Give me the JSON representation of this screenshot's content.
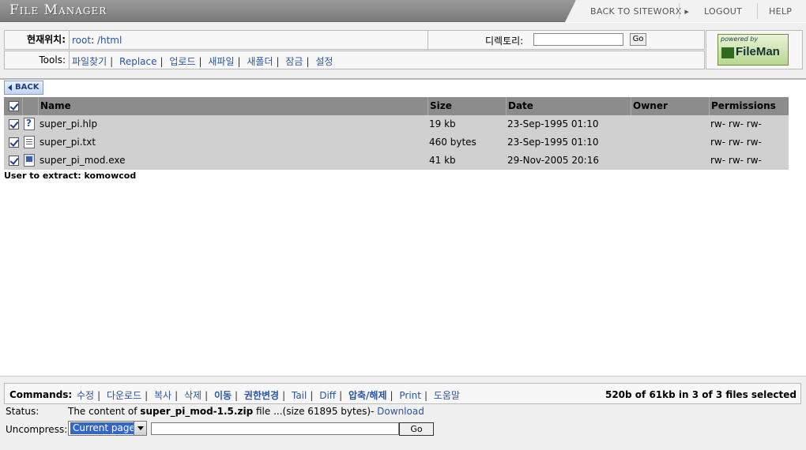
{
  "app": {
    "title": "File Manager"
  },
  "topnav": {
    "back": "BACK TO SITEWORX ▸",
    "logout": "LOGOUT",
    "help": "HELP"
  },
  "location": {
    "label": "현재위치:",
    "root": "root",
    "colon": ":",
    "path": "/html"
  },
  "directory": {
    "label": "디렉토리:",
    "value": "",
    "go": "Go"
  },
  "tools": {
    "label": "Tools:",
    "items": [
      "파일찾기",
      "Replace",
      "업로드",
      "새파일",
      "새폴더",
      "잠금",
      "설정"
    ]
  },
  "logo": {
    "powered": "powered by",
    "name": "FileMan"
  },
  "back_button": "BACK",
  "table": {
    "headers": {
      "name": "Name",
      "size": "Size",
      "date": "Date",
      "owner": "Owner",
      "permissions": "Permissions"
    },
    "rows": [
      {
        "name": "super_pi.hlp",
        "size": "19 kb",
        "date": "23-Sep-1995 01:10",
        "owner": "",
        "permissions": "rw- rw- rw-",
        "icon": "help-file-icon"
      },
      {
        "name": "super_pi.txt",
        "size": "460 bytes",
        "date": "23-Sep-1995 01:10",
        "owner": "",
        "permissions": "rw- rw- rw-",
        "icon": "text-file-icon"
      },
      {
        "name": "super_pi_mod.exe",
        "size": "41 kb",
        "date": "29-Nov-2005 20:16",
        "owner": "",
        "permissions": "rw- rw- rw-",
        "icon": "exe-file-icon"
      }
    ]
  },
  "extract_user": "User to extract: komowcod",
  "commands": {
    "label": "Commands:",
    "items": [
      "수정",
      "다운로드",
      "복사",
      "삭제",
      "이동",
      "권한변경",
      "Tail",
      "Diff",
      "압축/해제",
      "Print",
      "도움말"
    ],
    "summary": "520b of 61kb in 3 of 3 files selected"
  },
  "status": {
    "label": "Status:",
    "prefix": "The content of",
    "filename": "super_pi_mod-1.5.zip",
    "middle": "file ...(size 61895 bytes)-",
    "link": "Download"
  },
  "uncompress": {
    "label": "Uncompress:",
    "selected": "Current page",
    "path": "",
    "go": "Go"
  },
  "colors": {
    "link": "#2a55a5",
    "header_bg": "#8c8c8c",
    "row_bg": "#d0d0d0"
  }
}
